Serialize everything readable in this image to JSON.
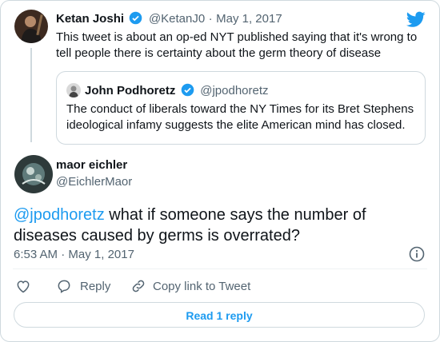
{
  "quoted_parent": {
    "author_name": "Ketan Joshi",
    "handle": "@KetanJ0",
    "separator": "·",
    "date": "May 1, 2017",
    "text": "This tweet is about an op-ed NYT published saying that it's wrong to tell people there is certainty about the germ theory of disease"
  },
  "quote": {
    "author_name": "John Podhoretz",
    "handle": "@jpodhoretz",
    "text": "The conduct of liberals toward the NY Times for its Bret Stephens ideological infamy suggests the elite American mind has closed."
  },
  "reply": {
    "author_name": "maor eichler",
    "handle": "@EichlerMaor",
    "mention": "@jpodhoretz",
    "text": " what if someone says the number of diseases caused by germs is overrated?",
    "time": "6:53 AM",
    "separator": "·",
    "date": "May 1, 2017"
  },
  "actions": {
    "reply_label": "Reply",
    "copy_link_label": "Copy link to Tweet",
    "read_replies_label": "Read 1 reply"
  },
  "colors": {
    "accent": "#1d9bf0",
    "muted_text": "#536471",
    "border": "#cfd9de"
  },
  "icons": [
    "twitter-bird-icon",
    "verified-badge-icon",
    "info-icon",
    "heart-icon",
    "reply-icon",
    "link-icon"
  ]
}
